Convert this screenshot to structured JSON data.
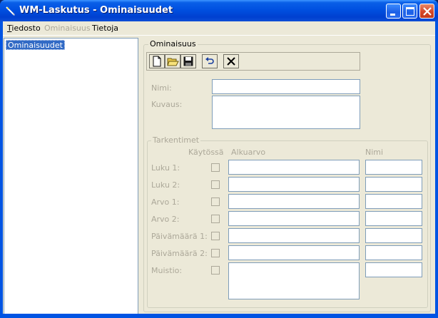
{
  "window": {
    "title": "WM-Laskutus - Ominaisuudet"
  },
  "menu": [
    {
      "label": "Tiedosto",
      "accel": "T",
      "rest": "iedosto",
      "enabled": true
    },
    {
      "label": "Ominaisuus",
      "enabled": false
    },
    {
      "label": "Tietoja",
      "enabled": true
    }
  ],
  "tree": {
    "items": [
      {
        "label": "Ominaisuudet",
        "selected": true
      }
    ]
  },
  "properties": {
    "group_label": "Ominaisuus",
    "toolbar": [
      {
        "name": "new-document-icon"
      },
      {
        "name": "open-folder-icon"
      },
      {
        "name": "save-disk-icon"
      },
      {
        "name": "undo-icon"
      },
      {
        "name": "delete-x-icon"
      }
    ],
    "name_label": "Nimi:",
    "name_value": "",
    "description_label": "Kuvaus:",
    "description_value": ""
  },
  "specifiers": {
    "group_label": "Tarkentimet",
    "col_in_use": "Käytössä",
    "col_initial_value": "Alkuarvo",
    "col_name": "Nimi",
    "rows": [
      {
        "label": "Luku 1:",
        "checked": false,
        "initial": "",
        "name": ""
      },
      {
        "label": "Luku 2:",
        "checked": false,
        "initial": "",
        "name": ""
      },
      {
        "label": "Arvo 1:",
        "checked": false,
        "initial": "",
        "name": ""
      },
      {
        "label": "Arvo 2:",
        "checked": false,
        "initial": "",
        "name": ""
      },
      {
        "label": "Päivämäärä 1:",
        "checked": false,
        "initial": "",
        "name": ""
      },
      {
        "label": "Päivämäärä 2:",
        "checked": false,
        "initial": "",
        "name": ""
      },
      {
        "label": "Muistio:",
        "checked": false,
        "initial": "",
        "name": ""
      }
    ]
  },
  "colors": {
    "titlebar": "#0054e3",
    "selection": "#316ac5",
    "disabled_text": "#aca899",
    "face": "#ece9d8"
  }
}
